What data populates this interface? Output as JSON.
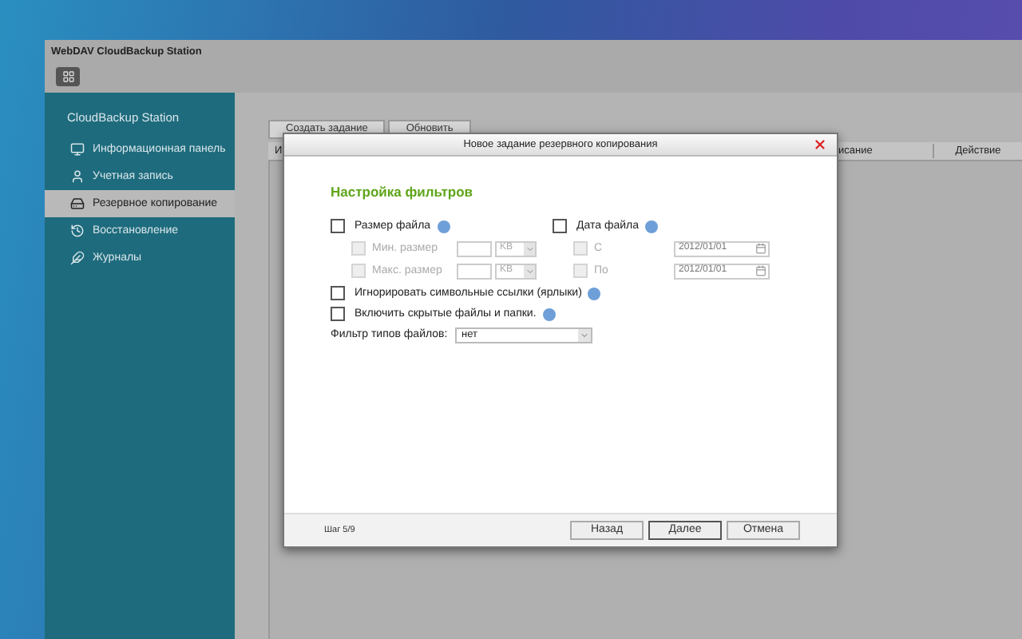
{
  "window": {
    "title": "WebDAV CloudBackup Station"
  },
  "sidebar": {
    "heading": "CloudBackup Station",
    "items": [
      {
        "label": "Информационная панель",
        "selected": false
      },
      {
        "label": "Учетная запись",
        "selected": false
      },
      {
        "label": "Резервное копирование",
        "selected": true
      },
      {
        "label": "Восстановление",
        "selected": false
      },
      {
        "label": "Журналы",
        "selected": false
      }
    ]
  },
  "toolbar": {
    "buttons": [
      "Создать задание",
      "Обновить"
    ]
  },
  "table": {
    "columns": [
      "И",
      "исание",
      "Действие"
    ]
  },
  "dialog": {
    "title": "Новое задание резервного копирования",
    "section_title": "Настройка фильтров",
    "file_size": {
      "label": "Размер файла",
      "checked": false,
      "rows": [
        {
          "label": "Мин. размер",
          "checked": false,
          "disabled": true,
          "unit": "KB"
        },
        {
          "label": "Макс. размер",
          "checked": false,
          "disabled": true,
          "unit": "KB"
        }
      ]
    },
    "file_date": {
      "label": "Дата файла",
      "checked": false,
      "rows": [
        {
          "label": "С",
          "checked": false,
          "disabled": true,
          "value": "2012/01/01"
        },
        {
          "label": "По",
          "checked": false,
          "disabled": true,
          "value": "2012/01/01"
        }
      ]
    },
    "options": [
      {
        "label": "Игнорировать символьные ссылки (ярлыки)",
        "checked": false
      },
      {
        "label": "Включить скрытые файлы и папки.",
        "checked": false
      }
    ],
    "file_type_filter": {
      "label": "Фильтр типов файлов:",
      "value": "нет"
    },
    "step": "Шаг 5/9",
    "buttons": [
      "Назад",
      "Далее",
      "Отмена"
    ]
  }
}
